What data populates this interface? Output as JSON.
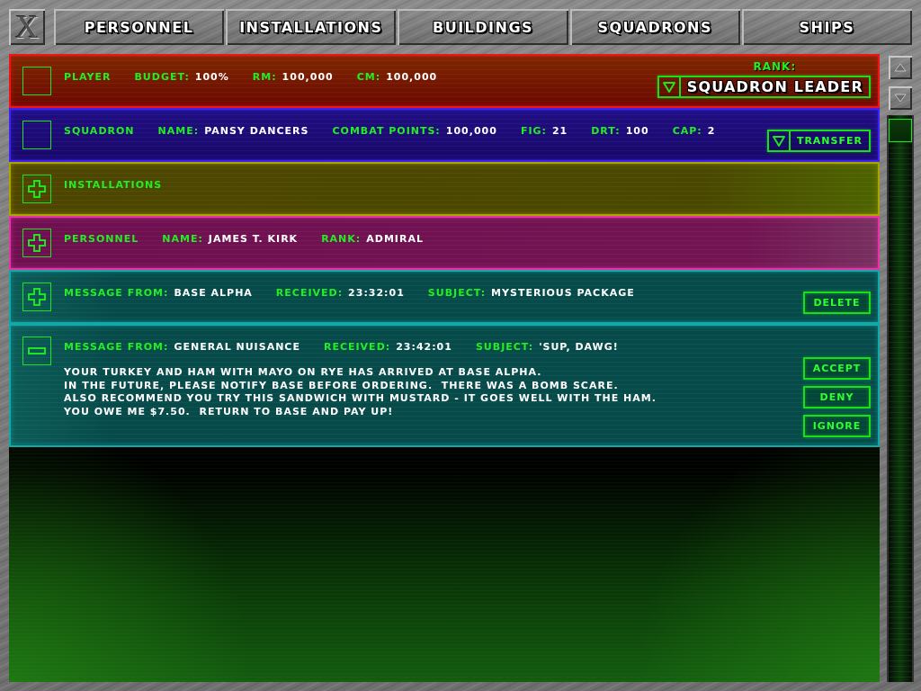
{
  "close_button": {
    "label": "X"
  },
  "tabs": [
    {
      "label": "PERSONNEL",
      "selected": false
    },
    {
      "label": "INSTALLATIONS",
      "selected": false
    },
    {
      "label": "BUILDINGS",
      "selected": false
    },
    {
      "label": "SQUADRONS",
      "selected": false
    },
    {
      "label": "SHIPS",
      "selected": false
    }
  ],
  "panels": [
    {
      "kind": "player",
      "title": "PLAYER",
      "fields": [
        {
          "label": "BUDGET:",
          "value": "100%"
        },
        {
          "label": "RM:",
          "value": "100,000"
        },
        {
          "label": "CM:",
          "value": "100,000"
        }
      ],
      "rank_select": {
        "label": "RANK:",
        "value": "SQUADRON LEADER"
      }
    },
    {
      "kind": "squadron",
      "title": "SQUADRON",
      "fields": [
        {
          "label": "NAME:",
          "value": "PANSY DANCERS"
        },
        {
          "label": "COMBAT POINTS:",
          "value": "100,000"
        },
        {
          "label": "FIG:",
          "value": "21"
        },
        {
          "label": "DRT:",
          "value": "100"
        },
        {
          "label": "CAP:",
          "value": "2"
        }
      ],
      "transfer_button": {
        "label": "TRANSFER"
      }
    },
    {
      "kind": "installations",
      "title": "INSTALLATIONS",
      "expanded": false
    },
    {
      "kind": "personnel",
      "title": "PERSONNEL",
      "expanded": false,
      "fields": [
        {
          "label": "NAME:",
          "value": "JAMES T. KIRK"
        },
        {
          "label": "RANK:",
          "value": "ADMIRAL"
        }
      ]
    },
    {
      "kind": "message",
      "expanded": false,
      "fields": [
        {
          "label": "MESSAGE FROM:",
          "value": "BASE ALPHA"
        },
        {
          "label": "RECEIVED:",
          "value": "23:32:01"
        },
        {
          "label": "SUBJECT:",
          "value": "MYSTERIOUS PACKAGE"
        }
      ],
      "buttons": [
        "DELETE"
      ]
    },
    {
      "kind": "message",
      "expanded": true,
      "fields": [
        {
          "label": "MESSAGE FROM:",
          "value": "GENERAL NUISANCE"
        },
        {
          "label": "RECEIVED:",
          "value": "23:42:01"
        },
        {
          "label": "SUBJECT:",
          "value": "'SUP, DAWG!"
        }
      ],
      "body": "YOUR TURKEY AND HAM WITH MAYO ON RYE HAS ARRIVED AT BASE ALPHA.\nIN THE FUTURE, PLEASE NOTIFY BASE BEFORE ORDERING.  THERE WAS A BOMB SCARE.\nALSO RECOMMEND YOU TRY THIS SANDWICH WITH MUSTARD - IT GOES WELL WITH THE HAM.\nYOU OWE ME $7.50.  RETURN TO BASE AND PAY UP!",
      "buttons": [
        "ACCEPT",
        "DENY",
        "IGNORE"
      ]
    }
  ]
}
